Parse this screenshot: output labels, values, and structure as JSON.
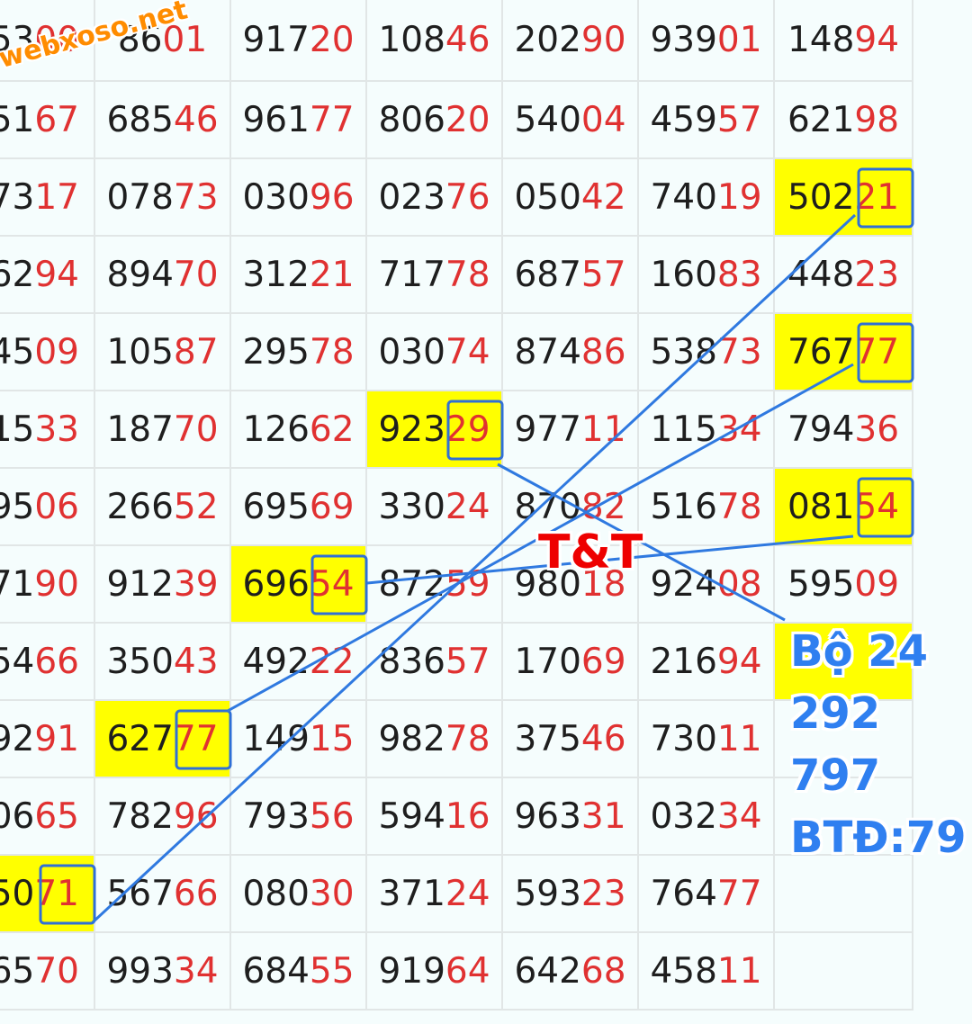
{
  "watermark": "webxoso.net",
  "overlay_label": "T&T",
  "note": {
    "line1": "Bộ 24",
    "line2": "292",
    "line3": "797",
    "line4": "BTĐ:79"
  },
  "colors": {
    "highlight": "#ffff00",
    "tail_digits": "#e03131",
    "lines": "#2f79e0",
    "note": "#2f7ff0",
    "label": "#ee0000",
    "watermark": "#ff8c00"
  },
  "grid": {
    "rows": [
      [
        {
          "head": "53",
          "tail": "00"
        },
        {
          "head": "86",
          "tail": "01"
        },
        {
          "head": "917",
          "tail": "20"
        },
        {
          "head": "108",
          "tail": "46"
        },
        {
          "head": "202",
          "tail": "90"
        },
        {
          "head": "939",
          "tail": "01"
        },
        {
          "head": "148",
          "tail": "94"
        }
      ],
      [
        {
          "head": "51",
          "tail": "67"
        },
        {
          "head": "685",
          "tail": "46"
        },
        {
          "head": "961",
          "tail": "77"
        },
        {
          "head": "806",
          "tail": "20"
        },
        {
          "head": "540",
          "tail": "04"
        },
        {
          "head": "459",
          "tail": "57"
        },
        {
          "head": "621",
          "tail": "98"
        }
      ],
      [
        {
          "head": "73",
          "tail": "17"
        },
        {
          "head": "078",
          "tail": "73"
        },
        {
          "head": "030",
          "tail": "96"
        },
        {
          "head": "023",
          "tail": "76"
        },
        {
          "head": "050",
          "tail": "42"
        },
        {
          "head": "740",
          "tail": "19"
        },
        {
          "head": "502",
          "tail": "21",
          "hl": true,
          "boxed": true
        }
      ],
      [
        {
          "head": "62",
          "tail": "94"
        },
        {
          "head": "894",
          "tail": "70"
        },
        {
          "head": "312",
          "tail": "21"
        },
        {
          "head": "717",
          "tail": "78"
        },
        {
          "head": "687",
          "tail": "57"
        },
        {
          "head": "160",
          "tail": "83"
        },
        {
          "head": "448",
          "tail": "23"
        }
      ],
      [
        {
          "head": "45",
          "tail": "09"
        },
        {
          "head": "105",
          "tail": "87"
        },
        {
          "head": "295",
          "tail": "78"
        },
        {
          "head": "030",
          "tail": "74"
        },
        {
          "head": "874",
          "tail": "86"
        },
        {
          "head": "538",
          "tail": "73"
        },
        {
          "head": "767",
          "tail": "77",
          "hl": true,
          "boxed": true
        }
      ],
      [
        {
          "head": "15",
          "tail": "33"
        },
        {
          "head": "187",
          "tail": "70"
        },
        {
          "head": "126",
          "tail": "62"
        },
        {
          "head": "923",
          "tail": "29",
          "hl": true,
          "boxed": true
        },
        {
          "head": "977",
          "tail": "11"
        },
        {
          "head": "115",
          "tail": "34"
        },
        {
          "head": "794",
          "tail": "36"
        }
      ],
      [
        {
          "head": "95",
          "tail": "06"
        },
        {
          "head": "266",
          "tail": "52"
        },
        {
          "head": "695",
          "tail": "69"
        },
        {
          "head": "330",
          "tail": "24"
        },
        {
          "head": "870",
          "tail": "82"
        },
        {
          "head": "516",
          "tail": "78"
        },
        {
          "head": "081",
          "tail": "54",
          "hl": true,
          "boxed": true
        }
      ],
      [
        {
          "head": "71",
          "tail": "90"
        },
        {
          "head": "912",
          "tail": "39"
        },
        {
          "head": "696",
          "tail": "54",
          "hl": true,
          "boxed": true
        },
        {
          "head": "872",
          "tail": "59"
        },
        {
          "head": "980",
          "tail": "18"
        },
        {
          "head": "924",
          "tail": "08"
        },
        {
          "head": "595",
          "tail": "09"
        }
      ],
      [
        {
          "head": "54",
          "tail": "66"
        },
        {
          "head": "350",
          "tail": "43"
        },
        {
          "head": "492",
          "tail": "22"
        },
        {
          "head": "836",
          "tail": "57"
        },
        {
          "head": "170",
          "tail": "69"
        },
        {
          "head": "216",
          "tail": "94"
        },
        {
          "head": "",
          "tail": "",
          "hl": true
        }
      ],
      [
        {
          "head": "92",
          "tail": "91"
        },
        {
          "head": "627",
          "tail": "77",
          "hl": true,
          "boxed": true
        },
        {
          "head": "149",
          "tail": "15"
        },
        {
          "head": "982",
          "tail": "78"
        },
        {
          "head": "375",
          "tail": "46"
        },
        {
          "head": "730",
          "tail": "11"
        },
        {
          "head": "",
          "tail": ""
        }
      ],
      [
        {
          "head": "06",
          "tail": "65"
        },
        {
          "head": "782",
          "tail": "96"
        },
        {
          "head": "793",
          "tail": "56"
        },
        {
          "head": "594",
          "tail": "16"
        },
        {
          "head": "963",
          "tail": "31"
        },
        {
          "head": "032",
          "tail": "34"
        },
        {
          "head": "",
          "tail": ""
        }
      ],
      [
        {
          "head": "50",
          "tail": "71",
          "hl": true,
          "boxed": true
        },
        {
          "head": "567",
          "tail": "66"
        },
        {
          "head": "080",
          "tail": "30"
        },
        {
          "head": "371",
          "tail": "24"
        },
        {
          "head": "593",
          "tail": "23"
        },
        {
          "head": "764",
          "tail": "77"
        },
        {
          "head": "",
          "tail": ""
        }
      ],
      [
        {
          "head": "65",
          "tail": "70"
        },
        {
          "head": "993",
          "tail": "34"
        },
        {
          "head": "684",
          "tail": "55"
        },
        {
          "head": "919",
          "tail": "64"
        },
        {
          "head": "642",
          "tail": "68"
        },
        {
          "head": "458",
          "tail": "11"
        },
        {
          "head": "",
          "tail": ""
        }
      ]
    ]
  }
}
